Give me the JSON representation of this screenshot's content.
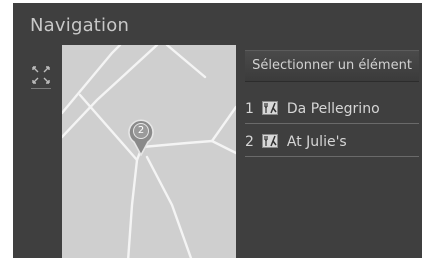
{
  "header": {
    "title": "Navigation"
  },
  "map": {
    "pin": {
      "label": "2"
    }
  },
  "panel": {
    "prompt": "Sélectionner un élément",
    "results": [
      {
        "number": "1",
        "icon": "restaurant-icon",
        "name": "Da Pellegrino"
      },
      {
        "number": "2",
        "icon": "restaurant-icon",
        "name": "At Julie's"
      }
    ]
  },
  "colors": {
    "screen_bg": "#3f3f3f",
    "map_bg": "#cfcfcf",
    "road": "#f2f2f2",
    "text": "#d6d6d6"
  }
}
